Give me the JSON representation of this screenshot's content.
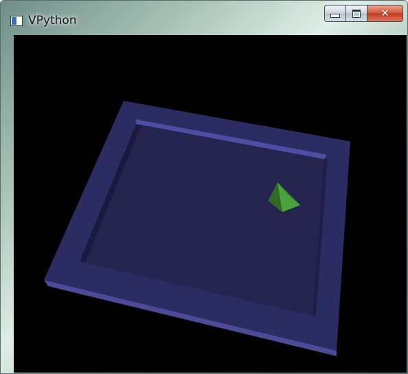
{
  "window": {
    "title": "VPython",
    "app_icon": "vpython-window-icon",
    "controls": {
      "minimize_icon": "minimize-icon",
      "maximize_icon": "maximize-icon",
      "close_icon": "close-icon"
    }
  },
  "scene": {
    "background_color": "#000000",
    "objects": [
      {
        "name": "box-board",
        "kind": "flat box with raised rim",
        "color": "#2a2a5e"
      },
      {
        "name": "pyramid",
        "kind": "pyramid",
        "color": "#3e8a2e"
      }
    ]
  }
}
